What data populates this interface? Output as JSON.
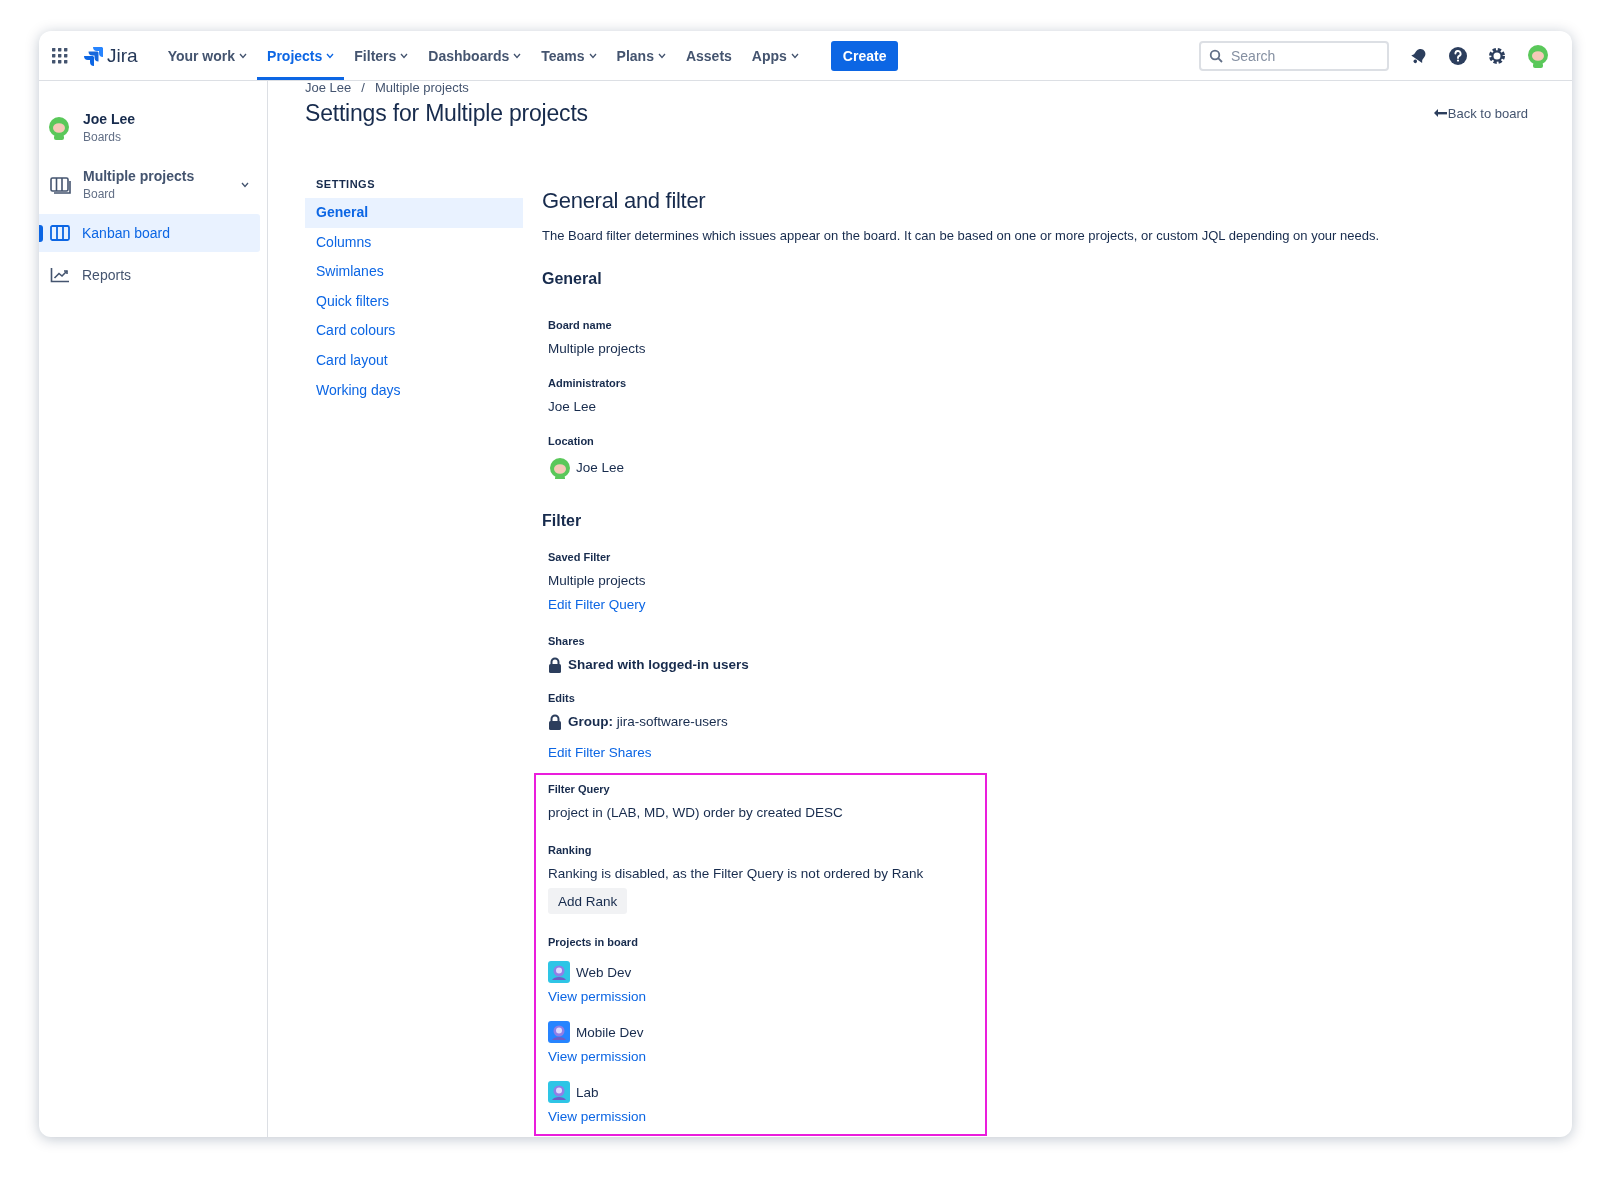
{
  "nav": {
    "product": "Jira",
    "items": [
      {
        "label": "Your work",
        "selected": false,
        "dropdown": true
      },
      {
        "label": "Projects",
        "selected": true,
        "dropdown": true
      },
      {
        "label": "Filters",
        "selected": false,
        "dropdown": true
      },
      {
        "label": "Dashboards",
        "selected": false,
        "dropdown": true
      },
      {
        "label": "Teams",
        "selected": false,
        "dropdown": true
      },
      {
        "label": "Plans",
        "selected": false,
        "dropdown": true
      },
      {
        "label": "Assets",
        "selected": false,
        "dropdown": false
      },
      {
        "label": "Apps",
        "selected": false,
        "dropdown": true
      }
    ],
    "create_button": "Create",
    "search": {
      "placeholder": "Search"
    }
  },
  "sidebar": {
    "user": {
      "name": "Joe Lee",
      "subtitle": "Boards"
    },
    "board": {
      "name": "Multiple projects",
      "subtitle": "Board"
    },
    "items": [
      {
        "label": "Kanban board",
        "kind": "board",
        "selected": true
      },
      {
        "label": "Reports",
        "kind": "reports",
        "selected": false
      }
    ]
  },
  "breadcrumbs": {
    "separator": "/",
    "items": [
      "Joe Lee",
      "Multiple projects"
    ]
  },
  "page_title": "Settings for Multiple projects",
  "back_link": "Back to board",
  "settings_menu": {
    "heading": "SETTINGS",
    "items": [
      {
        "label": "General",
        "selected": true
      },
      {
        "label": "Columns",
        "selected": false
      },
      {
        "label": "Swimlanes",
        "selected": false
      },
      {
        "label": "Quick filters",
        "selected": false
      },
      {
        "label": "Card colours",
        "selected": false
      },
      {
        "label": "Card layout",
        "selected": false
      },
      {
        "label": "Working days",
        "selected": false
      }
    ]
  },
  "content": {
    "heading": "General and filter",
    "description": "The Board filter determines which issues appear on the board. It can be based on one or more projects, or custom JQL depending on your needs.",
    "general": {
      "title": "General",
      "fields": [
        {
          "label": "Board name",
          "value": "Multiple projects",
          "kind": "text"
        },
        {
          "label": "Administrators",
          "value": "Joe Lee",
          "kind": "text"
        },
        {
          "label": "Location",
          "value": "Joe Lee",
          "kind": "avatar"
        }
      ]
    },
    "filter": {
      "title": "Filter",
      "saved_filter": {
        "label": "Saved Filter",
        "value": "Multiple projects",
        "link": "Edit Filter Query"
      },
      "shares": {
        "label": "Shares",
        "value": "Shared with logged-in users"
      },
      "edits": {
        "label": "Edits",
        "prefix": "Group:",
        "value": "jira-software-users"
      },
      "edit_shares_link": "Edit Filter Shares",
      "highlighted": {
        "filter_query": {
          "label": "Filter Query",
          "value": "project in (LAB, MD, WD) order by created DESC"
        },
        "ranking": {
          "label": "Ranking",
          "text": "Ranking is disabled, as the Filter Query is not ordered by Rank",
          "button": "Add Rank"
        },
        "projects": {
          "label": "Projects in board",
          "items": [
            {
              "name": "Web Dev",
              "link": "View permission",
              "color": "#2ec5e6"
            },
            {
              "name": "Mobile Dev",
              "link": "View permission",
              "color": "#2684ff"
            },
            {
              "name": "Lab",
              "link": "View permission",
              "color": "#2ec5e6"
            }
          ]
        }
      }
    }
  }
}
